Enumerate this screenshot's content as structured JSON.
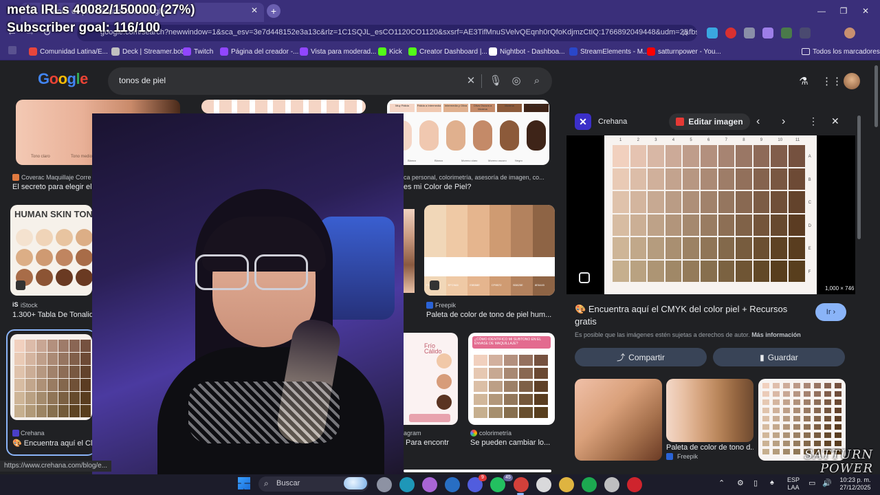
{
  "overlay": {
    "meta_line": "meta IRLs 40082/150000 (27%)",
    "meta_progress": 0.27,
    "subscriber_line": "Subscriber goal: 116/100",
    "watermark": "SATTURN POWER"
  },
  "browser": {
    "tab_title": "tonos de piel - Buscar con Google",
    "url": "google.com/search?newwindow=1&sca_esv=3e7d448152e3a13c&rlz=1C1SQJL_esCO1120CO1120&sxsrf=AE3TifMnuSVelvQEqnh0rQfoKdjmzCtIQ:1766892049448&udm=2&fbs=...",
    "bookmarks": [
      {
        "label": "Comunidad Latina/E...",
        "color": "#e8453c"
      },
      {
        "label": "Deck | Streamer.bot",
        "color": "#c0c0c0"
      },
      {
        "label": "Twitch",
        "color": "#9146ff"
      },
      {
        "label": "Página del creador -...",
        "color": "#9146ff"
      },
      {
        "label": "Vista para moderad...",
        "color": "#9146ff"
      },
      {
        "label": "Kick",
        "color": "#53fc18"
      },
      {
        "label": "Creator Dashboard |...",
        "color": "#53fc18"
      },
      {
        "label": "Nightbot - Dashboa...",
        "color": "#ffffff"
      },
      {
        "label": "StreamElements - M...",
        "color": "#2a47c9"
      },
      {
        "label": "satturnpower - You...",
        "color": "#ff0000"
      }
    ],
    "all_bookmarks": "Todos los marcadores",
    "status_url": "https://www.crehana.com/blog/e..."
  },
  "google": {
    "logo": "Google",
    "query": "tonos de piel",
    "results": {
      "r1_source": "Coverac Maquillaje Corre",
      "r1_title": "El secreto para elegir el",
      "r1_small1": "Tono claro",
      "r1_small2": "Tono medio",
      "r3_source": "ca personal, colorimetría, asesoría de imagen, co...",
      "r3_title": "es mi Color de Piel?",
      "r3_labels": [
        "Muy Pálida",
        "Pálida a Intermedia",
        "Intermedia y Oliva",
        "Oliva Oscura a Morena",
        "Morena",
        "Muy oscura"
      ],
      "r3_sublabels": [
        "Blanco",
        "Blanco",
        "Moreno claro",
        "Moreno oscuro",
        "Negro"
      ],
      "r4_heading": "HUMAN SKIN TON",
      "r4_source": "iStock",
      "r4_title": "1.300+ Tabla De Tonalid",
      "r5_source": "Freepik",
      "r5_title": "Paleta de color de tono de piel hum...",
      "r5_codes": [
        "F1D7B8",
        "EFC9A5",
        "E5B58E",
        "CF9B72",
        "B3825E",
        "8E6445"
      ],
      "r6_source": "Crehana",
      "r6_title": "Encuentra aquí el Cl",
      "r7_source": "agram",
      "r7_title": "Para encontr",
      "r7_words": [
        "Frío",
        "Cálido"
      ],
      "r8_heading": "¿CÓMO IDENTIFICO MI SUBTONO EN EL ENVASE DE MAQUILLAJE?",
      "r8_source": "colorimetría",
      "r8_title": "Se pueden cambiar lo..."
    }
  },
  "panel": {
    "source": "Crehana",
    "edit_button": "Editar imagen",
    "dimensions": "1,000 × 746",
    "grid_cols": [
      "1",
      "2",
      "3",
      "4",
      "5",
      "6",
      "7",
      "8",
      "9",
      "10",
      "11"
    ],
    "grid_rows": [
      "A",
      "B",
      "C",
      "D",
      "E",
      "F"
    ],
    "title": "Encuentra aquí el CMYK del color piel + Recursos gratis",
    "go_button": "Ir",
    "copyright": "Es posible que las imágenes estén sujetas a derechos de autor.",
    "more_info": "Más información",
    "share_button": "Compartir",
    "save_button": "Guardar",
    "related_title": "Paleta de color de tono d...",
    "related_source": "Freepik"
  },
  "taskbar": {
    "search": "Buscar",
    "lang1": "ESP",
    "lang2": "LAA",
    "time": "10:23 p. m.",
    "date": "27/12/2025",
    "whatsapp_badge": "45",
    "discord_badge": "9"
  }
}
